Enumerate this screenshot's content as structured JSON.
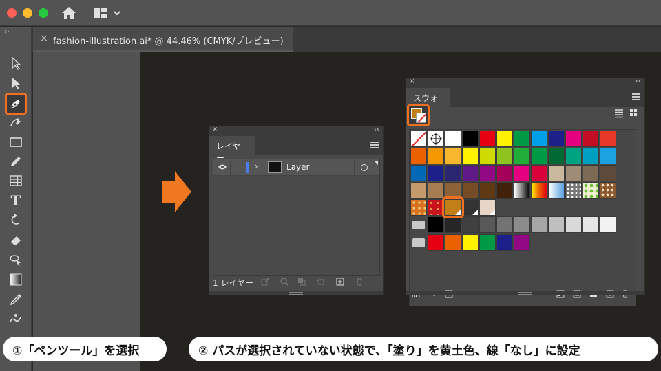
{
  "document_tab": {
    "close_glyph": "×",
    "title": "fashion-illustration.ai* @ 44.46% (CMYK/プレビュー)"
  },
  "toolbar": {
    "collapse_glyph": "››",
    "type_tool_glyph": "T",
    "selected_tool": "pen-tool"
  },
  "layers_panel": {
    "close_glyph": "×",
    "collapse_glyph": "‹‹",
    "tab_label": "レイヤー",
    "rows": [
      {
        "name": "Layer",
        "expand_glyph": "›"
      }
    ],
    "footer_count": "1 レイヤー"
  },
  "swatches_panel": {
    "close_glyph": "×",
    "collapse_glyph": "‹‹",
    "tab_label": "スウォッチ",
    "fill_color": "#c37f17",
    "stroke": "none",
    "rows": [
      [
        "none",
        "registration",
        "#ffffff",
        "#000000",
        "#e60012",
        "#fff100",
        "#009944",
        "#00a0e9",
        "#1d2088",
        "#e4007f",
        "#c30d23",
        "#e83828"
      ],
      [
        "#eb6100",
        "#f39800",
        "#f8b62d",
        "#fff100",
        "#cfdb00",
        "#8fc31f",
        "#22ac38",
        "#009944",
        "#006934",
        "#00a381",
        "#00a0c1",
        "#1ca2e0"
      ],
      [
        "#0068b7",
        "#1d2088",
        "#2a2670",
        "#601986",
        "#920783",
        "#a4005b",
        "#e4007f",
        "#d7003a",
        "#c8b89e",
        "#9f8c77",
        "#7d6a55",
        "#5c4a3a"
      ],
      [
        "#c49a6c",
        "#a67c52",
        "#8c6239",
        "#754c24",
        "#603913",
        "#42210b",
        "grad-bw",
        "grad-warm",
        "grad-blue",
        "pattern-dots",
        "pattern-leaf",
        "pattern-swirl"
      ],
      [
        "pattern-orange",
        "pattern-red",
        "#c37f17",
        "#333333",
        "#e8d5c8"
      ]
    ],
    "highlighted_swatch": "#c37f17",
    "gray_group": [
      "#000000",
      "#262626",
      "#404040",
      "#595959",
      "#737373",
      "#8c8c8c",
      "#a6a6a6",
      "#bfbfbf",
      "#d9d9d9",
      "#e6e6e6",
      "#f2f2f2"
    ],
    "color_group": [
      "#e60012",
      "#eb6100",
      "#fff100",
      "#009944",
      "#1d2088",
      "#920783"
    ]
  },
  "captions": {
    "step1": "①「ペンツール」を選択",
    "step2": "② パスが選択されていない状態で、「塗り」を黄土色、線「なし」に設定"
  },
  "colors": {
    "accent_orange": "#f07020",
    "layer_color": "#4a7df0"
  }
}
